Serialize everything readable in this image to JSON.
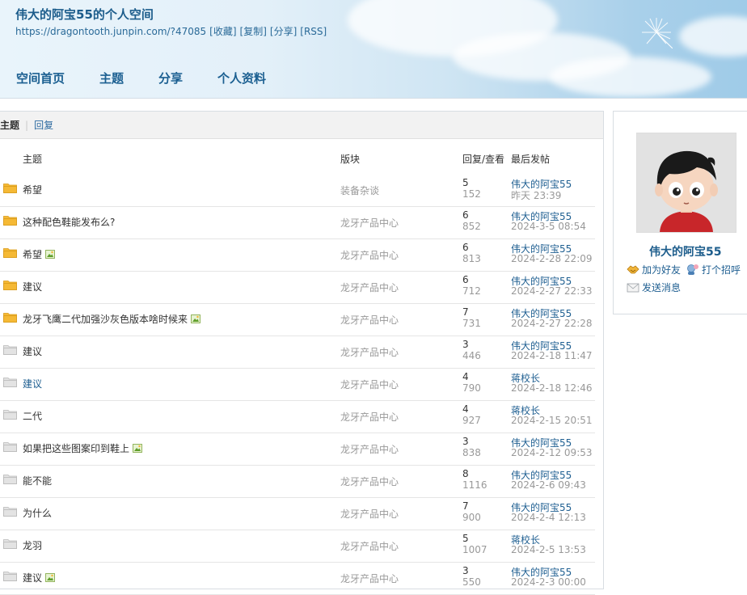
{
  "header": {
    "title": "伟大的阿宝55的个人空间",
    "url": "https://dragontooth.junpin.com/?47085",
    "actions": [
      "[收藏]",
      "[复制]",
      "[分享]",
      "[RSS]"
    ]
  },
  "nav": [
    "空间首页",
    "主题",
    "分享",
    "个人资料"
  ],
  "tabs": {
    "active": "主题",
    "other": "回复"
  },
  "table": {
    "headers": {
      "subject": "主题",
      "forum": "版块",
      "stats": "回复/查看",
      "last": "最后发帖"
    },
    "rows": [
      {
        "subject": "希望",
        "forum": "装备杂谈",
        "replies": "5",
        "views": "152",
        "author": "伟大的阿宝55",
        "time": "昨天 23:39",
        "folder": "yellow",
        "img": false,
        "link": false
      },
      {
        "subject": "这种配色鞋能发布么?",
        "forum": "龙牙产品中心",
        "replies": "6",
        "views": "852",
        "author": "伟大的阿宝55",
        "time": "2024-3-5 08:54",
        "folder": "yellow",
        "img": false,
        "link": false
      },
      {
        "subject": "希望",
        "forum": "龙牙产品中心",
        "replies": "6",
        "views": "813",
        "author": "伟大的阿宝55",
        "time": "2024-2-28 22:09",
        "folder": "yellow",
        "img": true,
        "link": false
      },
      {
        "subject": "建议",
        "forum": "龙牙产品中心",
        "replies": "6",
        "views": "712",
        "author": "伟大的阿宝55",
        "time": "2024-2-27 22:33",
        "folder": "yellow",
        "img": false,
        "link": false
      },
      {
        "subject": "龙牙飞鹰二代加强沙灰色版本啥时候来",
        "forum": "龙牙产品中心",
        "replies": "7",
        "views": "731",
        "author": "伟大的阿宝55",
        "time": "2024-2-27 22:28",
        "folder": "yellow",
        "img": true,
        "link": false
      },
      {
        "subject": "建议",
        "forum": "龙牙产品中心",
        "replies": "3",
        "views": "446",
        "author": "伟大的阿宝55",
        "time": "2024-2-18 11:47",
        "folder": "grey",
        "img": false,
        "link": false
      },
      {
        "subject": "建议",
        "forum": "龙牙产品中心",
        "replies": "4",
        "views": "790",
        "author": "蒋校长",
        "time": "2024-2-18 12:46",
        "folder": "grey",
        "img": false,
        "link": true
      },
      {
        "subject": "二代",
        "forum": "龙牙产品中心",
        "replies": "4",
        "views": "927",
        "author": "蒋校长",
        "time": "2024-2-15 20:51",
        "folder": "grey",
        "img": false,
        "link": false
      },
      {
        "subject": "如果把这些图案印到鞋上",
        "forum": "龙牙产品中心",
        "replies": "3",
        "views": "838",
        "author": "伟大的阿宝55",
        "time": "2024-2-12 09:53",
        "folder": "grey",
        "img": true,
        "link": false
      },
      {
        "subject": "能不能",
        "forum": "龙牙产品中心",
        "replies": "8",
        "views": "1116",
        "author": "伟大的阿宝55",
        "time": "2024-2-6 09:43",
        "folder": "grey",
        "img": false,
        "link": false
      },
      {
        "subject": "为什么",
        "forum": "龙牙产品中心",
        "replies": "7",
        "views": "900",
        "author": "伟大的阿宝55",
        "time": "2024-2-4 12:13",
        "folder": "grey",
        "img": false,
        "link": false
      },
      {
        "subject": "龙羽",
        "forum": "龙牙产品中心",
        "replies": "5",
        "views": "1007",
        "author": "蒋校长",
        "time": "2024-2-5 13:53",
        "folder": "grey",
        "img": false,
        "link": false
      },
      {
        "subject": "建议",
        "forum": "龙牙产品中心",
        "replies": "3",
        "views": "550",
        "author": "伟大的阿宝55",
        "time": "2024-2-3 00:00",
        "folder": "grey",
        "img": true,
        "link": false
      }
    ]
  },
  "profile": {
    "username": "伟大的阿宝55",
    "add_friend": "加为好友",
    "greet": "打个招呼",
    "message": "发送消息"
  },
  "colors": {
    "link": "#1f5f91",
    "muted": "#999999",
    "folder_yellow": "#f5b935",
    "folder_grey": "#e3e3e3"
  }
}
